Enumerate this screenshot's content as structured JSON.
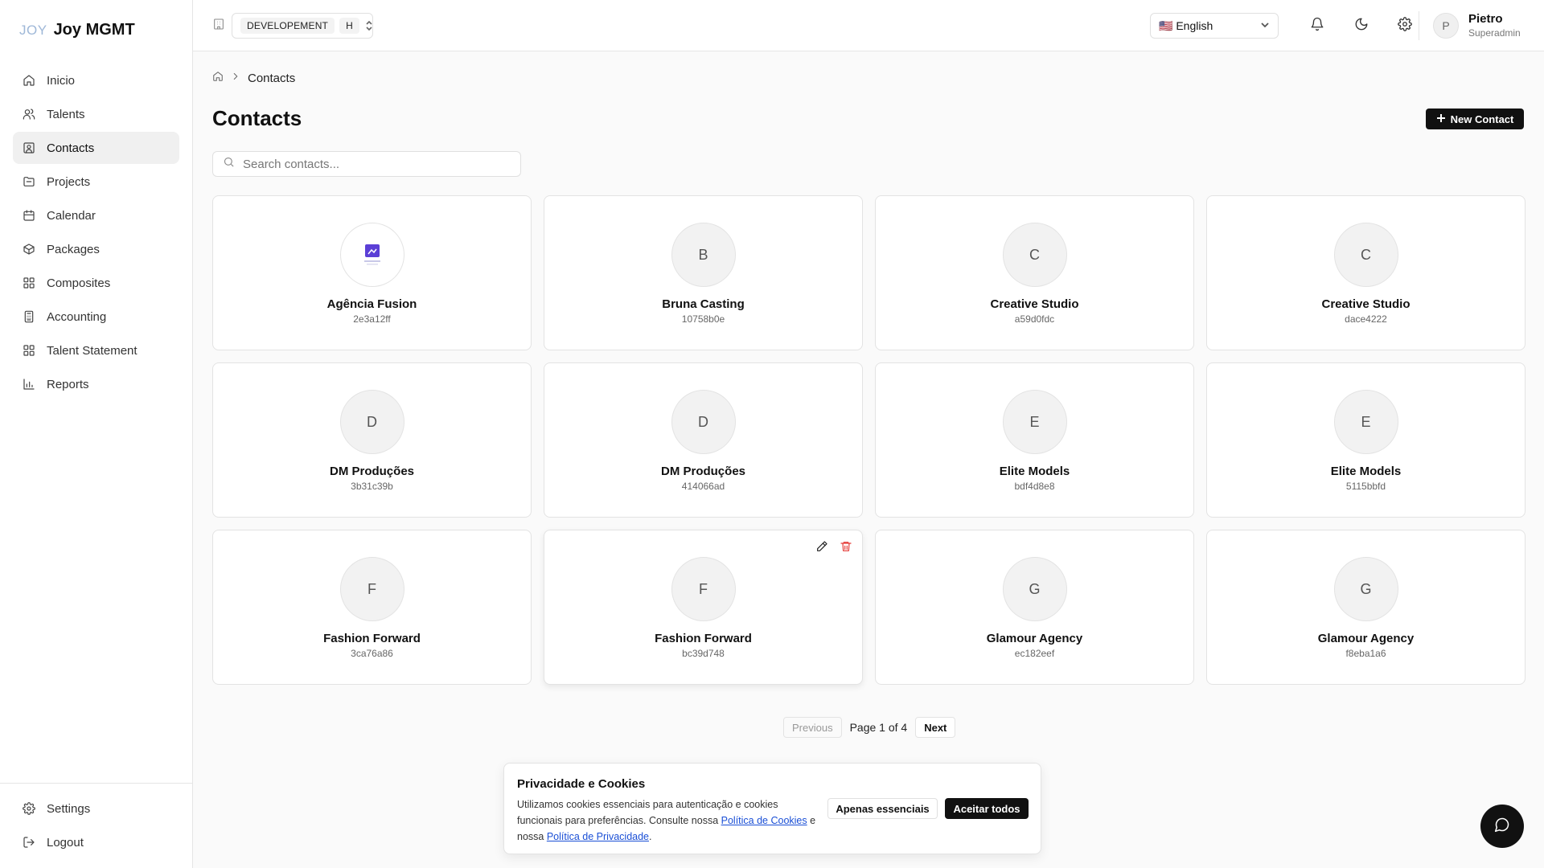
{
  "brand": {
    "logo_text": "JOY",
    "name": "Joy MGMT"
  },
  "sidebar": {
    "items": [
      {
        "label": "Inicio",
        "icon": "home-icon",
        "active": false
      },
      {
        "label": "Talents",
        "icon": "users-icon",
        "active": false
      },
      {
        "label": "Contacts",
        "icon": "contact-icon",
        "active": true
      },
      {
        "label": "Projects",
        "icon": "folder-icon",
        "active": false
      },
      {
        "label": "Calendar",
        "icon": "calendar-icon",
        "active": false
      },
      {
        "label": "Packages",
        "icon": "package-icon",
        "active": false
      },
      {
        "label": "Composites",
        "icon": "grid-icon",
        "active": false
      },
      {
        "label": "Accounting",
        "icon": "calculator-icon",
        "active": false
      },
      {
        "label": "Talent Statement",
        "icon": "grid-icon",
        "active": false
      },
      {
        "label": "Reports",
        "icon": "bar-chart-icon",
        "active": false
      }
    ],
    "bottom": [
      {
        "label": "Settings",
        "icon": "gear-icon"
      },
      {
        "label": "Logout",
        "icon": "logout-icon"
      }
    ]
  },
  "header": {
    "environment": "DEVELOPEMENT",
    "environment_short": "H",
    "language": "🇺🇸 English",
    "user": {
      "initial": "P",
      "name": "Pietro",
      "role": "Superadmin"
    }
  },
  "breadcrumb": {
    "current": "Contacts"
  },
  "page": {
    "title": "Contacts",
    "new_button": "New Contact",
    "search_placeholder": "Search contacts..."
  },
  "contacts": [
    {
      "name": "Agência Fusion",
      "id": "2e3a12ff",
      "initial": "",
      "has_logo": true
    },
    {
      "name": "Bruna Casting",
      "id": "10758b0e",
      "initial": "B"
    },
    {
      "name": "Creative Studio",
      "id": "a59d0fdc",
      "initial": "C"
    },
    {
      "name": "Creative Studio",
      "id": "dace4222",
      "initial": "C"
    },
    {
      "name": "DM Produções",
      "id": "3b31c39b",
      "initial": "D"
    },
    {
      "name": "DM Produções",
      "id": "414066ad",
      "initial": "D"
    },
    {
      "name": "Elite Models",
      "id": "bdf4d8e8",
      "initial": "E"
    },
    {
      "name": "Elite Models",
      "id": "5115bbfd",
      "initial": "E"
    },
    {
      "name": "Fashion Forward",
      "id": "3ca76a86",
      "initial": "F"
    },
    {
      "name": "Fashion Forward",
      "id": "bc39d748",
      "initial": "F",
      "hovered": true
    },
    {
      "name": "Glamour Agency",
      "id": "ec182eef",
      "initial": "G"
    },
    {
      "name": "Glamour Agency",
      "id": "f8eba1a6",
      "initial": "G"
    }
  ],
  "pagination": {
    "previous": "Previous",
    "status": "Page 1 of 4",
    "next": "Next"
  },
  "cookie": {
    "title": "Privacidade e Cookies",
    "text_1": "Utilizamos cookies essenciais para autenticação e cookies funcionais para preferências. Consulte nossa ",
    "link_1": "Política de Cookies",
    "text_2": " e nossa ",
    "link_2": "Política de Privacidade",
    "text_3": ".",
    "btn_essential": "Apenas essenciais",
    "btn_accept": "Aceitar todos"
  },
  "colors": {
    "accent": "#111111",
    "danger": "#e53935",
    "link": "#1a4fd6"
  }
}
